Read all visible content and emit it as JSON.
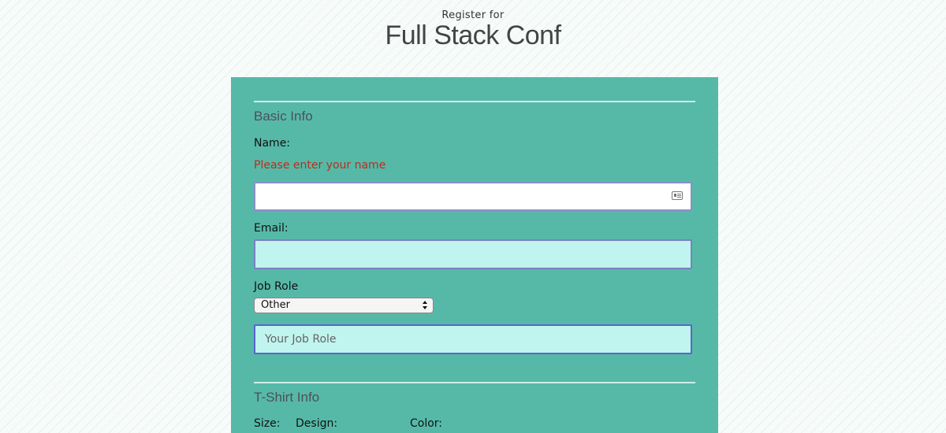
{
  "header": {
    "subtitle": "Register for",
    "title": "Full Stack Conf"
  },
  "basic_info": {
    "section_title": "Basic Info",
    "name_label": "Name:",
    "name_error": "Please enter your name",
    "name_value": "",
    "email_label": "Email:",
    "email_value": "",
    "job_role_label": "Job Role",
    "job_role_selected": "Other",
    "job_role_input_placeholder": "Your Job Role"
  },
  "tshirt_info": {
    "section_title": "T-Shirt Info",
    "size_label": "Size:",
    "design_label": "Design:",
    "color_label": "Color:"
  },
  "icons": {
    "name_field_icon": "contact-card-icon"
  }
}
